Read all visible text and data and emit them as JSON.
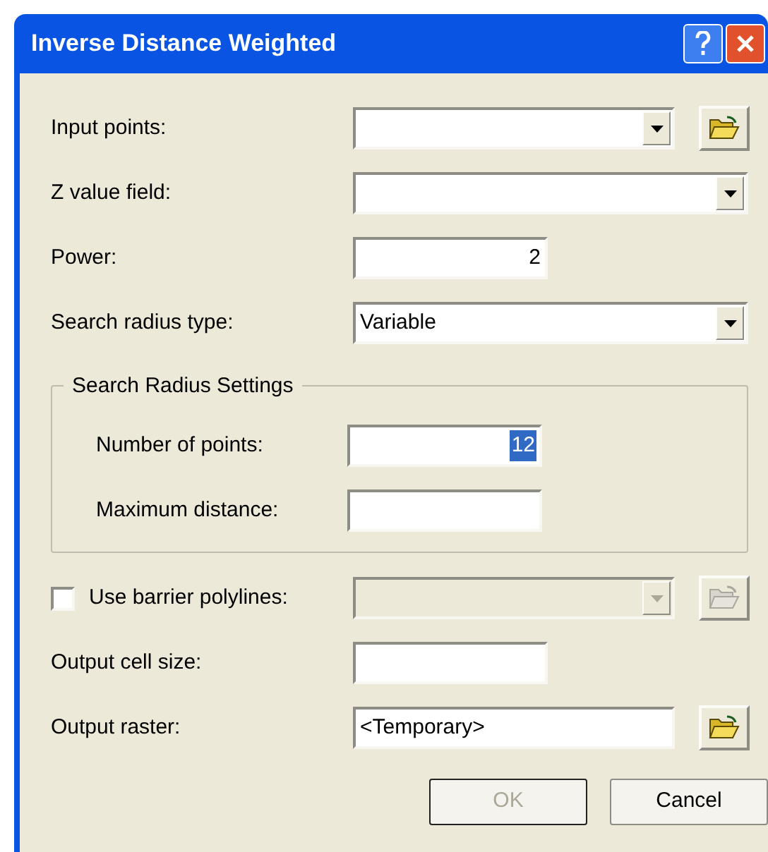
{
  "window": {
    "title": "Inverse Distance Weighted"
  },
  "rows": [
    {
      "kind": "combo",
      "label": "Input points:",
      "browse": true
    },
    {
      "kind": "combo",
      "label": "Z value field:",
      "browse": false
    },
    {
      "kind": "number",
      "label": "Power:",
      "value": "2",
      "highlighted": false
    },
    {
      "kind": "combo",
      "label": "Search radius type:",
      "value": "Variable",
      "browse": false
    }
  ],
  "group": {
    "title": "Search Radius Settings",
    "rows": [
      {
        "kind": "number",
        "label": "Number of points:",
        "value": "12",
        "highlighted": true
      },
      {
        "kind": "number",
        "label": "Maximum distance:"
      }
    ]
  },
  "lower_rows": [
    {
      "kind": "check-combo",
      "label": "Use barrier polylines:",
      "checked": false,
      "disabled": true,
      "browse": true
    },
    {
      "kind": "number",
      "label": "Output cell size:"
    },
    {
      "kind": "text",
      "label": "Output raster:",
      "value": "<Temporary>",
      "browse": true
    }
  ],
  "buttons": [
    {
      "label": "OK",
      "disabled": true
    },
    {
      "label": "Cancel",
      "disabled": false
    }
  ]
}
